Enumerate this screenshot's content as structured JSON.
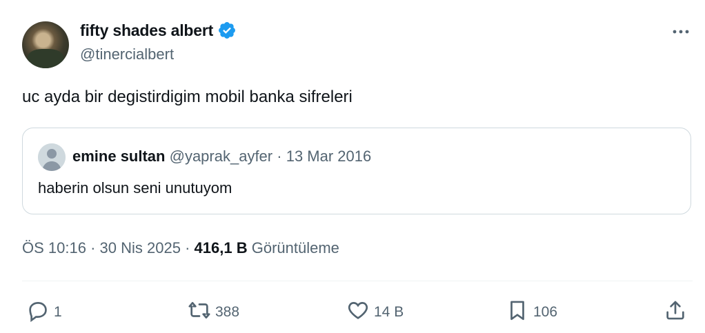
{
  "author": {
    "display_name": "fifty shades albert",
    "handle": "@tinercialbert",
    "verified": true
  },
  "tweet": {
    "text": "uc ayda bir degistirdigim mobil banka sifreleri"
  },
  "quoted": {
    "name": "emine sultan",
    "handle": "@yaprak_ayfer",
    "separator": "·",
    "date": "13 Mar 2016",
    "text": "haberin olsun seni unutuyom"
  },
  "meta": {
    "time": "ÖS 10:16",
    "sep1": "·",
    "date": "30 Nis 2025",
    "sep2": "·",
    "views_count": "416,1 B",
    "views_label": "Görüntüleme"
  },
  "actions": {
    "replies": "1",
    "reposts": "388",
    "likes": "14 B",
    "bookmarks": "106"
  },
  "colors": {
    "text_primary": "#0f1419",
    "text_secondary": "#536471",
    "verified_blue": "#1d9bf0",
    "border": "#cfd9de"
  }
}
